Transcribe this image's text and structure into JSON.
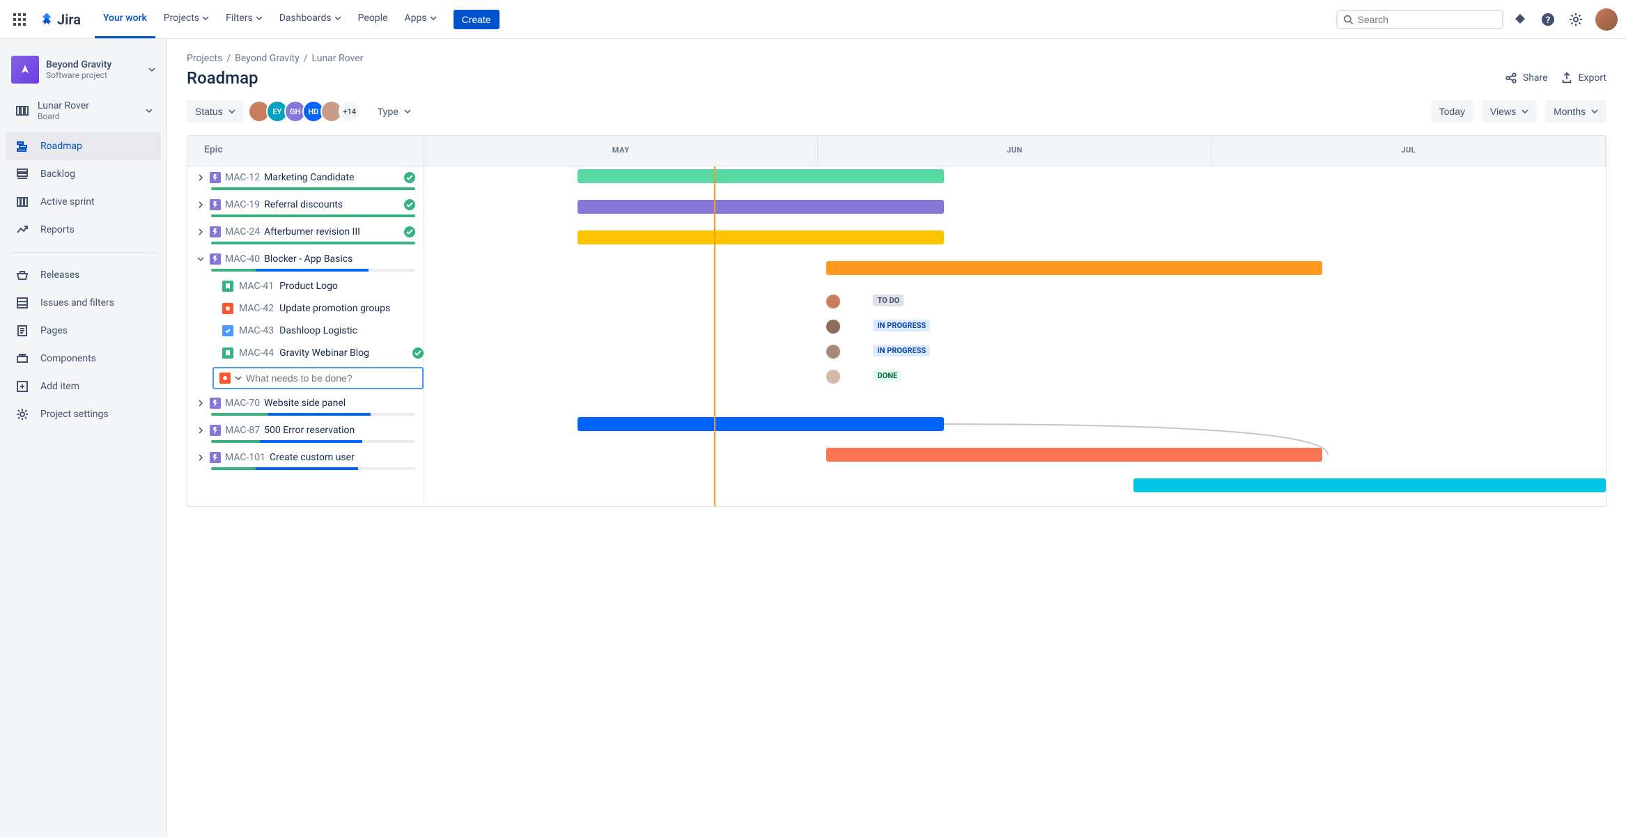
{
  "topbar": {
    "product": "Jira",
    "nav": [
      "Your work",
      "Projects",
      "Filters",
      "Dashboards",
      "People",
      "Apps"
    ],
    "create": "Create",
    "search_placeholder": "Search"
  },
  "sidebar": {
    "project": {
      "name": "Beyond Gravity",
      "sub": "Software project"
    },
    "board": {
      "name": "Lunar Rover",
      "sub": "Board"
    },
    "nav1": [
      "Roadmap",
      "Backlog",
      "Active sprint",
      "Reports"
    ],
    "nav2": [
      "Releases",
      "Issues and filters",
      "Pages",
      "Components",
      "Add item",
      "Project settings"
    ]
  },
  "breadcrumbs": [
    "Projects",
    "Beyond Gravity",
    "Lunar Rover"
  ],
  "page": {
    "title": "Roadmap",
    "share": "Share",
    "export": "Export"
  },
  "toolbar": {
    "status": "Status",
    "type": "Type",
    "avatars": [
      {
        "label": "",
        "bg": "#c97d5d"
      },
      {
        "label": "EY",
        "bg": "#00A3BF"
      },
      {
        "label": "GH",
        "bg": "#8777D9"
      },
      {
        "label": "HD",
        "bg": "#0065FF"
      },
      {
        "label": "",
        "bg": "#c99c8a"
      }
    ],
    "avatar_more": "+14",
    "today": "Today",
    "views": "Views",
    "months_btn": "Months"
  },
  "roadmap": {
    "left_header": "Epic",
    "months": [
      "MAY",
      "JUN",
      "JUL"
    ],
    "today_pct": 24.5,
    "epics": [
      {
        "key": "MAC-12",
        "title": "Marketing Candidate",
        "expanded": false,
        "status": "done",
        "progress": [
          100,
          0
        ],
        "bar": {
          "start": 13,
          "end": 44,
          "color": "#57D9A3"
        }
      },
      {
        "key": "MAC-19",
        "title": "Referral discounts",
        "expanded": false,
        "status": "done",
        "progress": [
          100,
          0
        ],
        "bar": {
          "start": 13,
          "end": 44,
          "color": "#8777D9"
        }
      },
      {
        "key": "MAC-24",
        "title": "Afterburner revision III",
        "expanded": false,
        "status": "done",
        "progress": [
          100,
          0
        ],
        "bar": {
          "start": 13,
          "end": 44,
          "color": "#FFC400"
        }
      },
      {
        "key": "MAC-40",
        "title": "Blocker - App Basics",
        "expanded": true,
        "progress": [
          22,
          55
        ],
        "bar": {
          "start": 34,
          "end": 76,
          "color": "#FF991F"
        },
        "children": [
          {
            "key": "MAC-41",
            "title": "Product Logo",
            "type": "story",
            "status": "TO DO",
            "status_kind": "todo",
            "avatar": "#c97d5d"
          },
          {
            "key": "MAC-42",
            "title": "Update promotion groups",
            "type": "bug",
            "status": "IN PROGRESS",
            "status_kind": "prog",
            "avatar": "#8b6d5a"
          },
          {
            "key": "MAC-43",
            "title": "Dashloop Logistic",
            "type": "task",
            "status": "IN PROGRESS",
            "status_kind": "prog",
            "avatar": "#a88a7a"
          },
          {
            "key": "MAC-44",
            "title": "Gravity Webinar Blog",
            "type": "story",
            "status": "DONE",
            "status_kind": "done",
            "done": true,
            "avatar": "#d4b8a8"
          }
        ],
        "new_placeholder": "What needs to be done?"
      },
      {
        "key": "MAC-70",
        "title": "Website side panel",
        "expanded": false,
        "progress": [
          28,
          50
        ],
        "bar": {
          "start": 13,
          "end": 44,
          "color": "#0065FF"
        }
      },
      {
        "key": "MAC-87",
        "title": "500 Error reservation",
        "expanded": false,
        "progress": [
          24,
          50
        ],
        "bar": {
          "start": 34,
          "end": 76,
          "color": "#FF7452",
          "dep_target": true
        }
      },
      {
        "key": "MAC-101",
        "title": "Create custom user",
        "expanded": false,
        "progress": [
          22,
          50
        ],
        "bar": {
          "start": 60,
          "end": 100,
          "color": "#00C7E6"
        }
      }
    ]
  }
}
